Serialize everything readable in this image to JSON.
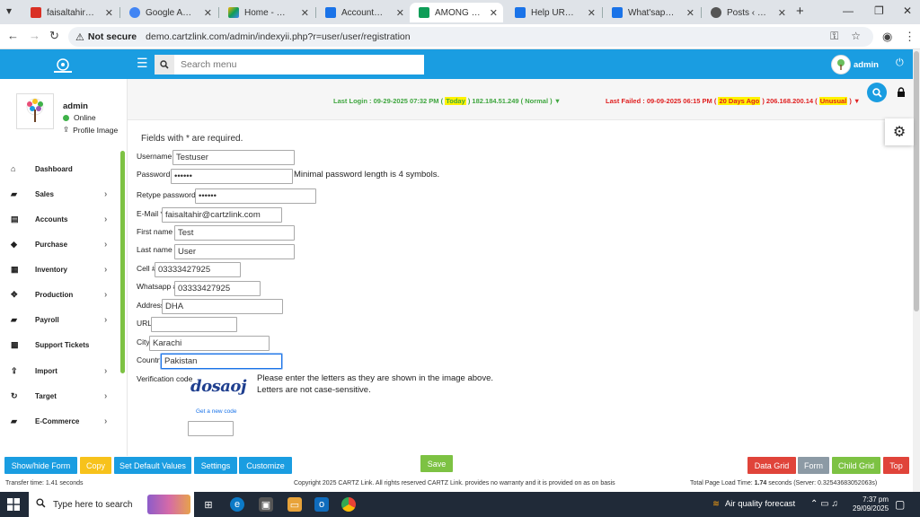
{
  "browser": {
    "tabs": [
      {
        "title": "faisaltahir@cartzli",
        "favicon": "gmail-icon",
        "color": "#d93025"
      },
      {
        "title": "Google Accounts",
        "favicon": "google-icon",
        "color": "#4285f4"
      },
      {
        "title": "Home - Google D",
        "favicon": "google-drive-icon",
        "color": "#f4b400"
      },
      {
        "title": "Accounts Master",
        "favicon": "docs-icon",
        "color": "#1a73e8"
      },
      {
        "title": "AMONG MOST SI",
        "favicon": "cartz-icon",
        "color": "#0f9d58"
      },
      {
        "title": "Help URL's for ERI",
        "favicon": "docs-icon",
        "color": "#1a73e8"
      },
      {
        "title": "What'sapp Sales",
        "favicon": "docs-icon",
        "color": "#1a73e8"
      },
      {
        "title": "Posts ‹ Streamline",
        "favicon": "wordpress-icon",
        "color": "#555555"
      }
    ],
    "new_tab": "+",
    "not_secure": "Not secure",
    "url": "demo.cartzlink.com/admin/indexyii.php?r=user/user/registration"
  },
  "header": {
    "search_placeholder": "Search menu",
    "user": "admin"
  },
  "sidebar": {
    "user": "admin",
    "status": "Online",
    "profile_link": "Profile Image",
    "items": [
      {
        "label": "Dashboard",
        "icon": "home-icon",
        "glyph": "⌂",
        "has_arrow": false
      },
      {
        "label": "Sales",
        "icon": "cart-icon",
        "glyph": "🛒",
        "has_arrow": true
      },
      {
        "label": "Accounts",
        "icon": "bank-icon",
        "glyph": "▤",
        "has_arrow": true
      },
      {
        "label": "Purchase",
        "icon": "tag-icon",
        "glyph": "◆",
        "has_arrow": true
      },
      {
        "label": "Inventory",
        "icon": "grid-icon",
        "glyph": "▦",
        "has_arrow": true
      },
      {
        "label": "Production",
        "icon": "cogs-icon",
        "glyph": "✥",
        "has_arrow": true
      },
      {
        "label": "Payroll",
        "icon": "money-icon",
        "glyph": "▰",
        "has_arrow": true
      },
      {
        "label": "Support Tickets",
        "icon": "apps-icon",
        "glyph": "▩",
        "has_arrow": false
      },
      {
        "label": "Import",
        "icon": "upload-icon",
        "glyph": "⇪",
        "has_arrow": true
      },
      {
        "label": "Target",
        "icon": "refresh-icon",
        "glyph": "↻",
        "has_arrow": true
      },
      {
        "label": "E-Commerce",
        "icon": "cart-icon",
        "glyph": "🛒",
        "has_arrow": true
      }
    ]
  },
  "info": {
    "last_login_prefix": "Last Login : 09-29-2025 07:32 PM (",
    "last_login_badge": "Today",
    "last_login_suffix": ") 182.184.51.249 ( Normal ) ▼",
    "last_failed_prefix": "Last Failed : 09-09-2025 06:15 PM (",
    "last_failed_badge": "20 Days Ago",
    "last_failed_mid": ") 206.168.200.14 (",
    "last_failed_badge2": "Unusual",
    "last_failed_suffix": ") ▼"
  },
  "form": {
    "required_note": "Fields with * are required.",
    "fields": {
      "username": {
        "label": "Username *",
        "value": "Testuser"
      },
      "password": {
        "label": "Password *",
        "value": "••••••",
        "hint": "Minimal password length is 4 symbols."
      },
      "retype": {
        "label": "Retype password *",
        "value": "••••••"
      },
      "email": {
        "label": "E-Mail *",
        "value": "faisaltahir@cartzlink.com"
      },
      "first_name": {
        "label": "First name *",
        "value": "Test"
      },
      "last_name": {
        "label": "Last name *",
        "value": "User"
      },
      "cell": {
        "label": "Cell #",
        "value": "03333427925"
      },
      "whatsapp": {
        "label": "Whatsapp #",
        "value": "03333427925"
      },
      "address": {
        "label": "Address",
        "value": "DHA"
      },
      "url": {
        "label": "URL",
        "value": ""
      },
      "city": {
        "label": "City",
        "value": "Karachi"
      },
      "country": {
        "label": "Country",
        "value": "Pakistan"
      }
    },
    "verification_label": "Verification code",
    "captcha_text": "dosaoj",
    "captcha_hint1": "Please enter the letters as they are shown in the image above.",
    "captcha_hint2": "Letters are not case-sensitive.",
    "new_code": "Get a new code",
    "code_value": ""
  },
  "buttons": {
    "show_hide": "Show/hide Form",
    "copy": "Copy",
    "defaults": "Set Default Values",
    "settings": "Settings",
    "customize": "Customize",
    "save": "Save",
    "data_grid": "Data Grid",
    "form": "Form",
    "child_grid": "Child Grid",
    "top": "Top"
  },
  "status": {
    "transfer": "Transfer time: 1.41 seconds",
    "copyright": "Copyright 2025 CARTZ Link. All rights reserved CARTZ Link. provides no warranty and it is provided on as on basis",
    "load_prefix": "Total Page Load Time:",
    "load_value": "1.74",
    "load_suffix": "seconds (Server: 0.32543683052063s)"
  },
  "taskbar": {
    "search": "Type here to search",
    "weather": "Air quality forecast",
    "time": "7:37 pm",
    "date": "29/09/2025",
    "notif_count": "1"
  },
  "colors": {
    "primary": "#1a9de1",
    "green": "#7dc243",
    "red": "#e0443a",
    "yellow": "#f7c21b"
  }
}
